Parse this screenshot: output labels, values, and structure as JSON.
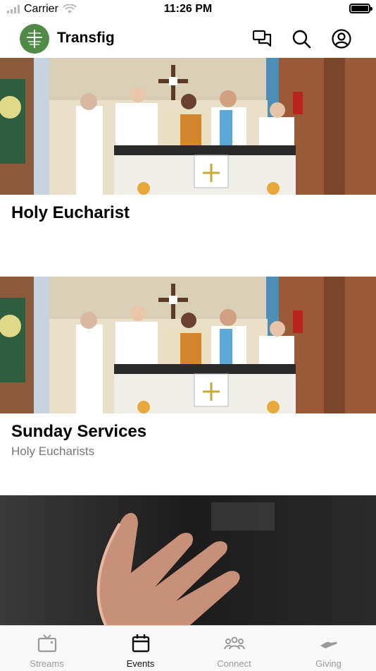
{
  "status_bar": {
    "carrier": "Carrier",
    "time": "11:26 PM"
  },
  "header": {
    "title": "Transfig",
    "logo_color": "#4f8a47",
    "icons": [
      "chat-icon",
      "search-icon",
      "account-icon"
    ]
  },
  "feed": {
    "items": [
      {
        "title": "Holy Eucharist",
        "subtitle": ""
      },
      {
        "title": "Sunday Services",
        "subtitle": "Holy Eucharists"
      },
      {
        "title": "",
        "subtitle": ""
      }
    ]
  },
  "tabbar": {
    "tabs": [
      {
        "label": "Streams",
        "icon": "tv-icon",
        "active": false
      },
      {
        "label": "Events",
        "icon": "calendar-icon",
        "active": true
      },
      {
        "label": "Connect",
        "icon": "people-icon",
        "active": false
      },
      {
        "label": "Giving",
        "icon": "hand-icon",
        "active": false
      }
    ]
  }
}
